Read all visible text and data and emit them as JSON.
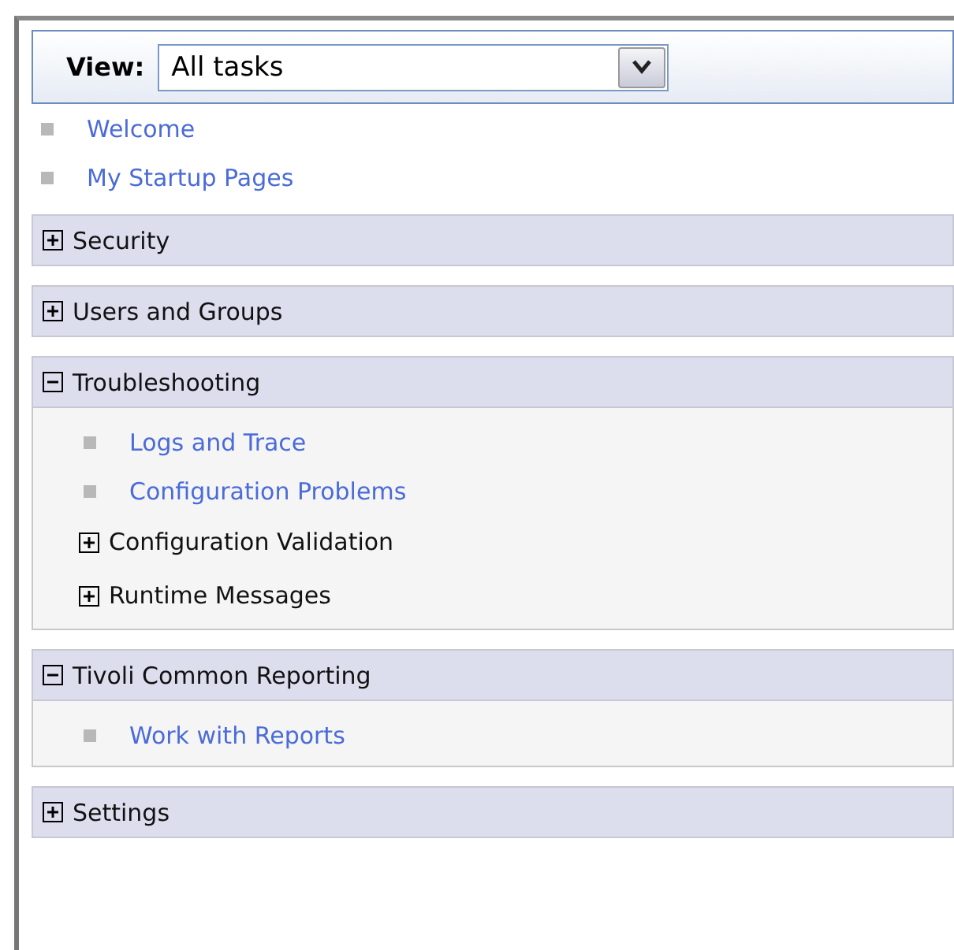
{
  "view": {
    "label": "View:",
    "value": "All tasks"
  },
  "links": [
    "Welcome",
    "My Startup Pages"
  ],
  "sections": [
    {
      "title": "Security",
      "expanded": false
    },
    {
      "title": "Users and Groups",
      "expanded": false
    },
    {
      "title": "Troubleshooting",
      "expanded": true,
      "items": [
        {
          "kind": "link",
          "label": "Logs and Trace"
        },
        {
          "kind": "link",
          "label": "Configuration Problems"
        },
        {
          "kind": "group",
          "label": "Configuration Validation",
          "expanded": false
        },
        {
          "kind": "group",
          "label": "Runtime Messages",
          "expanded": false
        }
      ]
    },
    {
      "title": "Tivoli Common Reporting",
      "expanded": true,
      "items": [
        {
          "kind": "link",
          "label": "Work with Reports"
        }
      ]
    },
    {
      "title": "Settings",
      "expanded": false
    }
  ]
}
